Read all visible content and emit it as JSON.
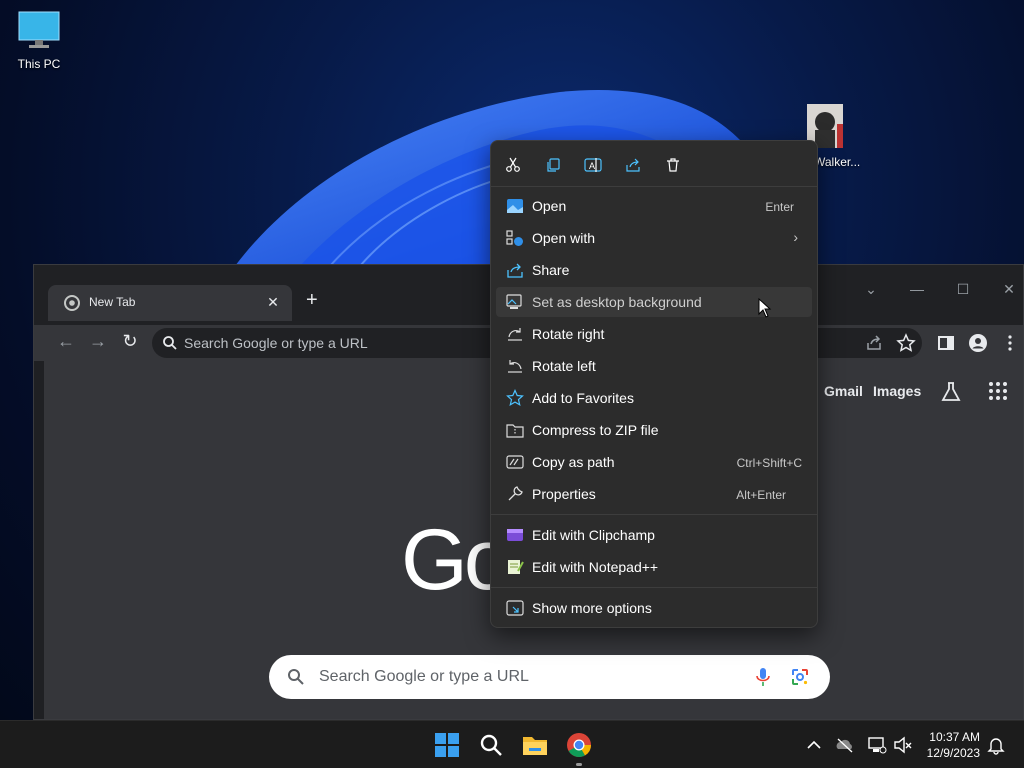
{
  "desktop": {
    "icons": [
      {
        "label": "This PC"
      },
      {
        "label": "Walker..."
      }
    ]
  },
  "browser": {
    "tab_title": "New Tab",
    "tab_close": "✕",
    "new_tab": "+",
    "omnibox_placeholder": "Search Google or type a URL",
    "links": {
      "gmail": "Gmail",
      "images": "Images"
    },
    "logo_partial": "Go",
    "search_placeholder": "Search Google or type a URL"
  },
  "context_menu": {
    "quick_actions": [
      {
        "icon": "cut-icon"
      },
      {
        "icon": "copy-icon"
      },
      {
        "icon": "rename-icon"
      },
      {
        "icon": "share-icon"
      },
      {
        "icon": "delete-icon"
      }
    ],
    "items": [
      {
        "label": "Open",
        "shortcut": "Enter",
        "icon": "photo-icon"
      },
      {
        "label": "Open with",
        "icon": "open-with-icon",
        "submenu": "›"
      },
      {
        "label": "Share",
        "icon": "share-icon"
      },
      {
        "label": "Set as desktop background",
        "icon": "desktop-background-icon"
      },
      {
        "label": "Rotate right",
        "icon": "rotate-right-icon"
      },
      {
        "label": "Rotate left",
        "icon": "rotate-left-icon"
      },
      {
        "label": "Add to Favorites",
        "icon": "star-icon"
      },
      {
        "label": "Compress to ZIP file",
        "icon": "zip-icon"
      },
      {
        "label": "Copy as path",
        "shortcut": "Ctrl+Shift+C",
        "icon": "copy-path-icon"
      },
      {
        "label": "Properties",
        "shortcut": "Alt+Enter",
        "icon": "wrench-icon"
      },
      {
        "label": "Edit with Clipchamp",
        "icon": "clipchamp-icon"
      },
      {
        "label": "Edit with Notepad++",
        "icon": "notepadpp-icon"
      },
      {
        "label": "Show more options",
        "icon": "more-options-icon"
      }
    ]
  },
  "taskbar": {
    "time": "10:37 AM",
    "date": "12/9/2023"
  },
  "colors": {
    "menu_bg": "#2c2c2c",
    "accent_blue": "#4cc2ff",
    "browser_bg": "#35363a"
  }
}
